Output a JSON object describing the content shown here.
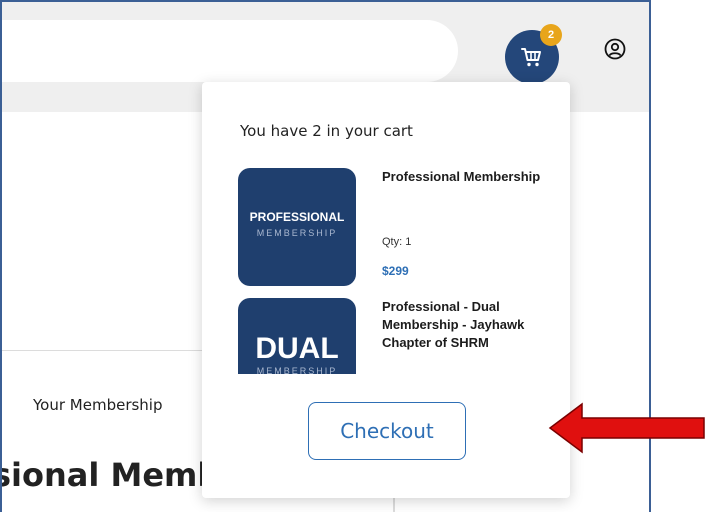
{
  "header": {
    "search_placeholder": "",
    "cart_count": "2",
    "cart_icon": "shopping-cart-icon",
    "account_icon": "user-account-icon"
  },
  "membership_section": {
    "label": "Your Membership",
    "title": "sional Memb"
  },
  "cart_dropdown": {
    "summary": "You have 2 in your cart",
    "items": [
      {
        "thumb_main": "PROFESSIONAL",
        "thumb_sub": "MEMBERSHIP",
        "name": "Professional Membership",
        "qty": "Qty: 1",
        "price": "$299"
      },
      {
        "thumb_main": "DUAL",
        "thumb_sub": "MEMBERSHIP",
        "name": "Professional - Dual Membership - Jayhawk Chapter of SHRM"
      }
    ],
    "checkout_label": "Checkout"
  },
  "colors": {
    "brand_navy": "#1f3f6e",
    "badge_gold": "#e8a51b",
    "link_blue": "#2e6fb5",
    "annotation_red": "#e0100f",
    "frame_border": "#3b5f95"
  }
}
